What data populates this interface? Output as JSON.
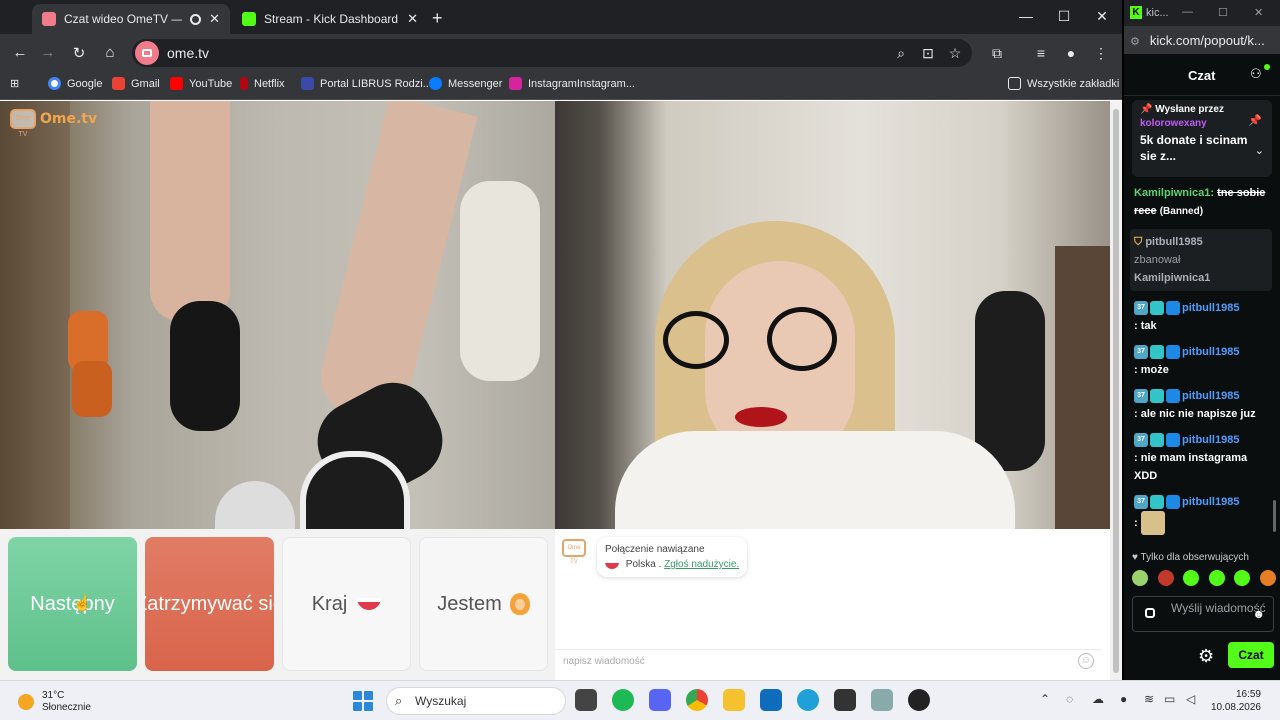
{
  "browser": {
    "tabs": [
      {
        "title": "Czat wideo OmeTV — alter",
        "active": true
      },
      {
        "title": "Stream - Kick Dashboard",
        "active": false
      }
    ],
    "url": "ome.tv",
    "bookmarks": [
      "Google",
      "Gmail",
      "YouTube",
      "Netflix",
      "Portal LIBRUS Rodzi...",
      "Messenger",
      "InstagramInstagram..."
    ],
    "all_bookmarks": "Wszystkie zakładki"
  },
  "ometv": {
    "logo": "Ome.tv",
    "logo_badge": "Ome TV",
    "buttons": {
      "next": "Następny",
      "stop": "Zatrzymywać się",
      "country": "Kraj",
      "iam": "Jestem"
    },
    "system_message": {
      "line1": "Połączenie nawiązane",
      "country": "Polska .",
      "report": "Zgłoś nadużycie."
    },
    "input_placeholder": "napisz wiadomość"
  },
  "kick": {
    "window_title": "kic...",
    "url": "kick.com/popout/k...",
    "header": "Czat",
    "pinned": {
      "by": "Wysłane przez",
      "user": "kolorowexany",
      "text": "5k donate i scinam sie z..."
    },
    "messages": [
      {
        "user": "Kamilpiwnica1:",
        "text": "tne sobie rece",
        "note": "(Banned)"
      },
      {
        "mod": "pitbull1985",
        "action": "zbanował",
        "target": "Kamilpiwnica1"
      },
      {
        "user": "pitbull1985",
        "text": ": tak"
      },
      {
        "user": "pitbull1985",
        "text": ": może"
      },
      {
        "user": "pitbull1985",
        "text": ": ale nic nie napisze juz"
      },
      {
        "user": "pitbull1985",
        "text": ": nie mam instagrama XDD"
      },
      {
        "user": "pitbull1985",
        "text": ":"
      }
    ],
    "badge_level": "37",
    "followers_only": "Tylko dla obserwujących",
    "input_placeholder": "Wyślij wiadomość",
    "send": "Czat"
  },
  "taskbar": {
    "temp": "31°C",
    "weather": "Słonecznie",
    "search": "Wyszukaj",
    "time": "16:59",
    "date": "10.08.2026"
  }
}
